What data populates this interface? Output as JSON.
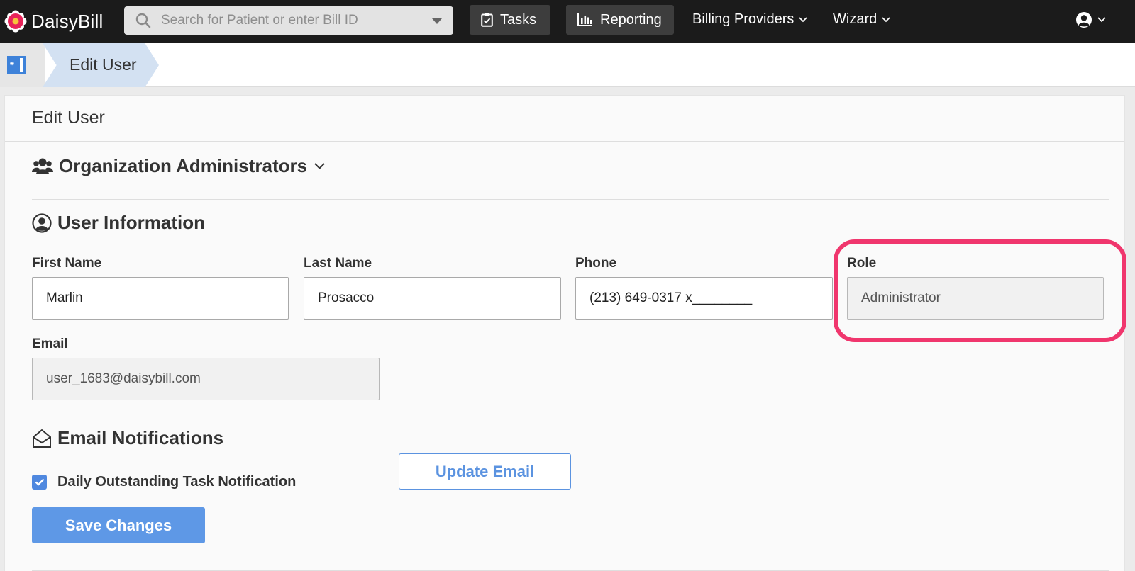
{
  "brand": {
    "name": "DaisyBill"
  },
  "search": {
    "placeholder": "Search for Patient or enter Bill ID"
  },
  "nav": {
    "tasks": "Tasks",
    "reporting": "Reporting",
    "billing_providers": "Billing Providers",
    "wizard": "Wizard"
  },
  "breadcrumb": {
    "current": "Edit User"
  },
  "panel": {
    "title": "Edit User",
    "organization": "Organization Administrators",
    "user_info_title": "User Information",
    "fields": {
      "first_name_label": "First Name",
      "first_name_value": "Marlin",
      "last_name_label": "Last Name",
      "last_name_value": "Prosacco",
      "phone_label": "Phone",
      "phone_value": "(213) 649-0317 x________",
      "role_label": "Role",
      "role_value": "Administrator",
      "email_label": "Email",
      "email_value": "user_1683@daisybill.com"
    },
    "update_email_label": "Update Email",
    "notifications_title": "Email Notifications",
    "daily_task_notification": {
      "label": "Daily Outstanding Task Notification",
      "checked": true
    },
    "save_label": "Save Changes"
  },
  "colors": {
    "topbar": "#1b1b1b",
    "accent": "#5e98e6",
    "highlight": "#f0366d"
  }
}
